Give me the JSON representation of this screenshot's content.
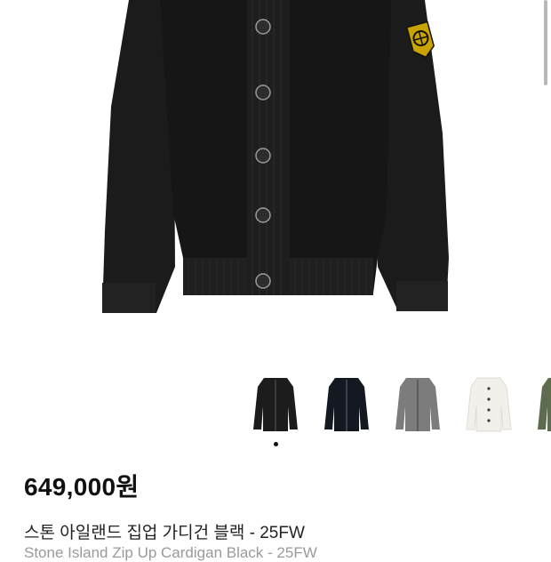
{
  "product": {
    "price": "649,000원",
    "title": "스톤 아일랜드 집업 가디건 블랙 - 25FW",
    "subtitle_partial": "Stone Island Zip Up Cardigan Black - 25FW"
  },
  "gallery": {
    "main_image": "black-knit-cardigan-with-compass-badge",
    "thumbnails": [
      {
        "name": "black-button-cardigan",
        "color": "#1c1c1c",
        "selected": true
      },
      {
        "name": "black-zip-cardigan",
        "color": "#141821",
        "selected": false
      },
      {
        "name": "grey-button-cardigan",
        "color": "#7c7c7c",
        "selected": false
      },
      {
        "name": "white-button-cardigan",
        "color": "#f2f0ea",
        "selected": false
      },
      {
        "name": "olive-cardigan",
        "color": "#5d6b4e",
        "selected": false
      }
    ],
    "active_index": 0
  },
  "colors": {
    "background": "#ffffff",
    "garment": "#1a1a1a",
    "badge": "#d9b300"
  }
}
